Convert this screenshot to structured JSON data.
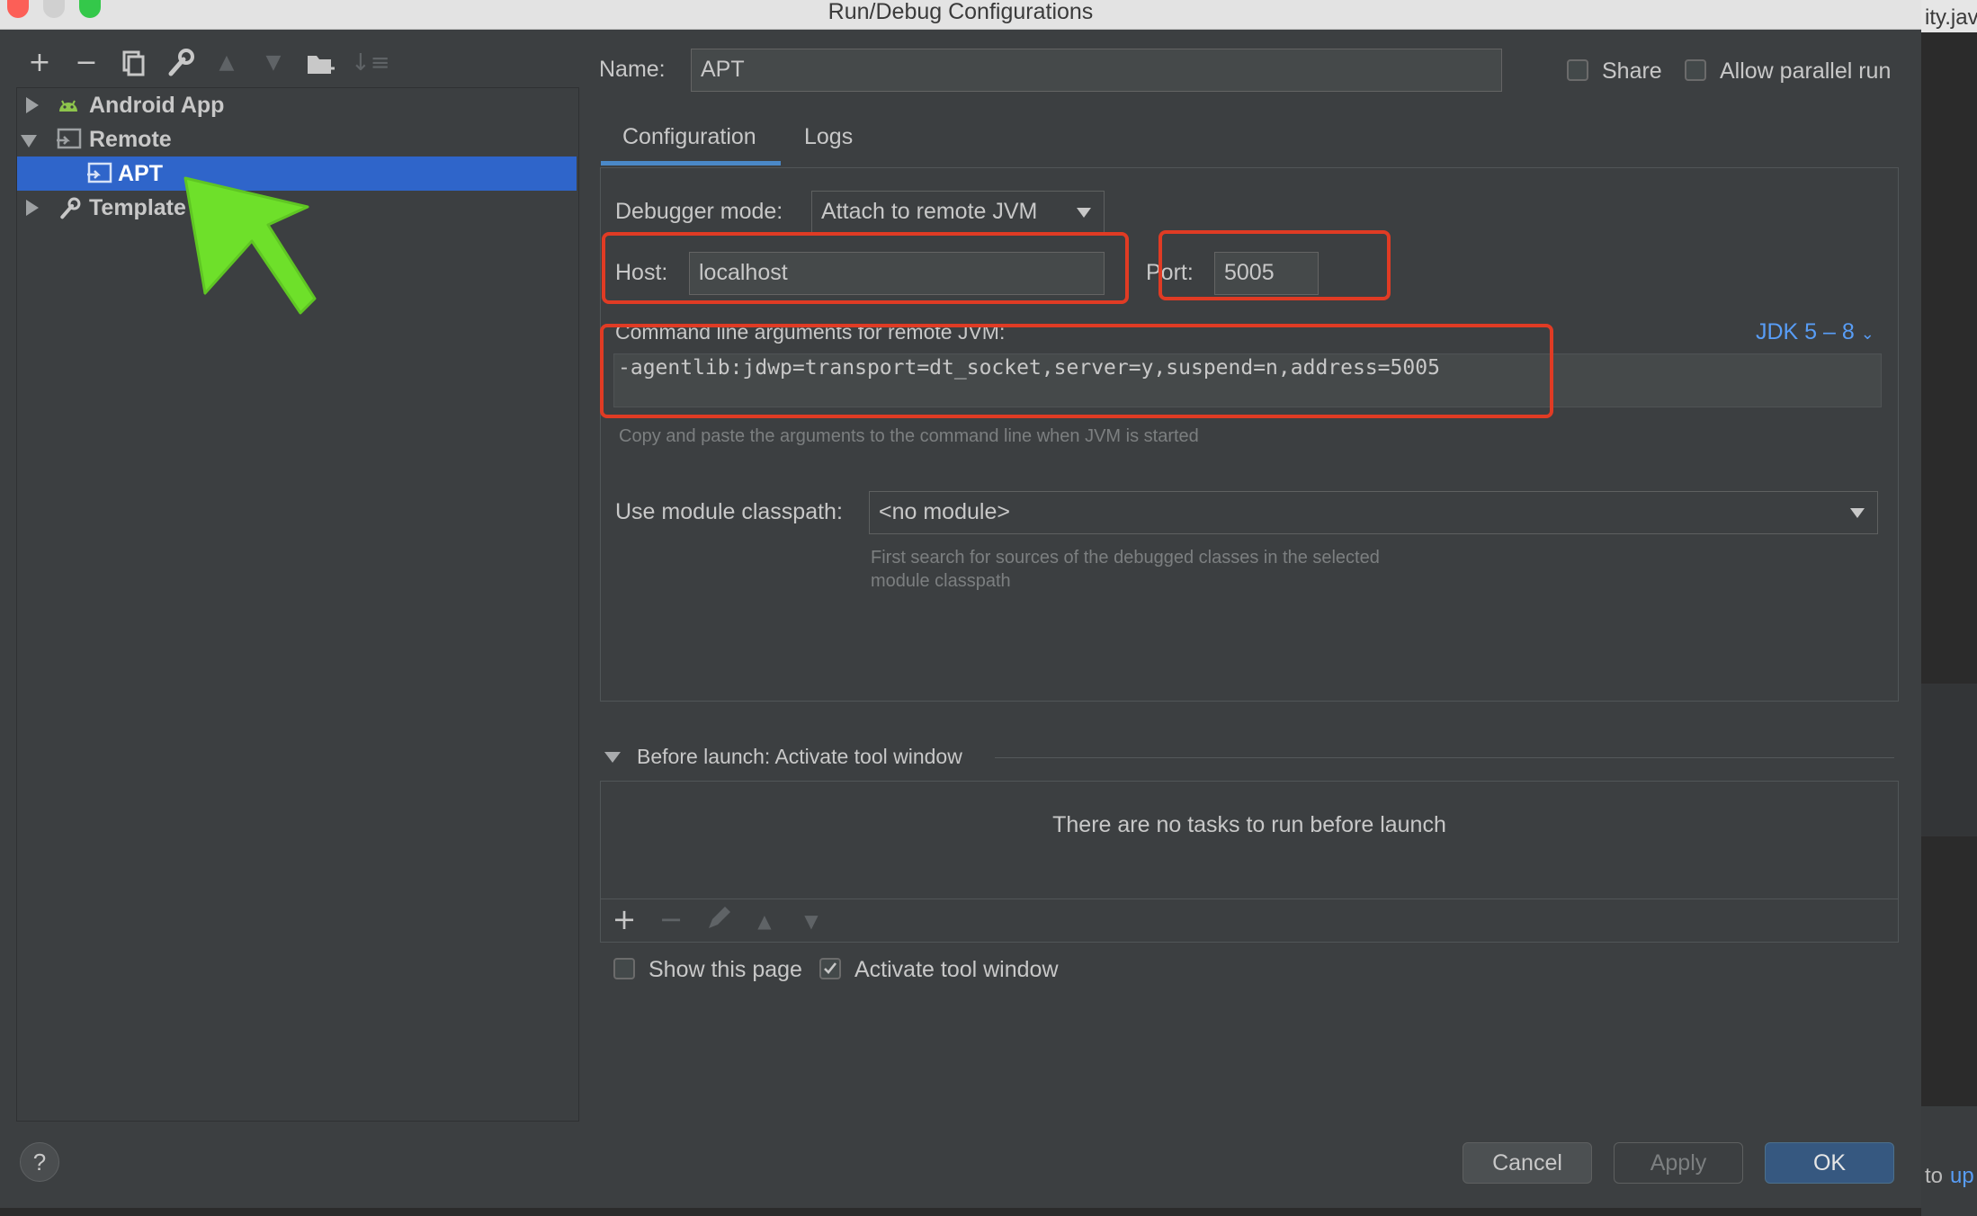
{
  "window": {
    "title": "Run/Debug Configurations"
  },
  "background_editor": {
    "tab_fragment": "ity.jav",
    "bottom_prefix": "to",
    "bottom_link": "up"
  },
  "left_toolbar": {
    "icons": [
      "plus-icon",
      "minus-icon",
      "copy-icon",
      "wrench-icon",
      "arrow-up-icon",
      "arrow-down-icon",
      "folder-add-icon",
      "sort-icon"
    ]
  },
  "tree": {
    "items": [
      {
        "label": "Android App",
        "expanded": false
      },
      {
        "label": "Remote",
        "expanded": true
      },
      {
        "label": "APT",
        "selected": true
      },
      {
        "label": "Template",
        "expanded": false
      }
    ]
  },
  "header": {
    "name_label": "Name:",
    "name_value": "APT",
    "share_label": "Share",
    "share_checked": false,
    "parallel_label": "Allow parallel run",
    "parallel_checked": false
  },
  "tabs": [
    {
      "label": "Configuration",
      "active": true
    },
    {
      "label": "Logs",
      "active": false
    }
  ],
  "config": {
    "debugger_mode_label": "Debugger mode:",
    "debugger_mode_value": "Attach to remote JVM",
    "host_label": "Host:",
    "host_value": "localhost",
    "port_label": "Port:",
    "port_value": "5005",
    "cmd_label": "Command line arguments for remote JVM:",
    "jdk_selector": "JDK 5 – 8",
    "cmd_value": "-agentlib:jdwp=transport=dt_socket,server=y,suspend=n,address=5005",
    "cmd_hint": "Copy and paste the arguments to the command line when JVM is started",
    "module_label": "Use module classpath:",
    "module_value": "<no module>",
    "module_hint_line1": "First search for sources of the debugged classes in the selected",
    "module_hint_line2": "module classpath"
  },
  "before_launch": {
    "title": "Before launch: Activate tool window",
    "empty_text": "There are no tasks to run before launch",
    "show_page_label": "Show this page",
    "show_page_checked": false,
    "activate_label": "Activate tool window",
    "activate_checked": true
  },
  "buttons": {
    "cancel": "Cancel",
    "apply": "Apply",
    "ok": "OK",
    "help": "?"
  },
  "colors": {
    "selection": "#2f65ca",
    "accent_link": "#589df6",
    "highlight_box": "#e03b24",
    "annotation_arrow": "#6ee02a"
  }
}
